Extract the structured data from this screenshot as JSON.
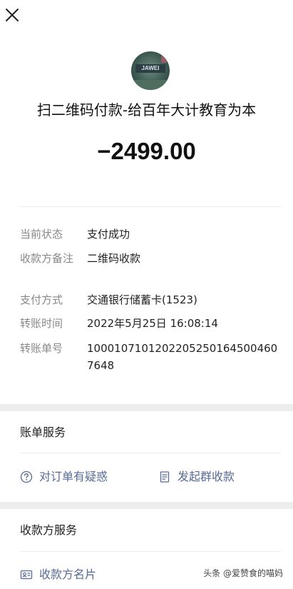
{
  "header": {
    "close_icon": "close-icon"
  },
  "merchant": {
    "avatar_text": "JAWEI",
    "title": "扫二维码付款-给百年大计教育为本"
  },
  "amount": "−2499.00",
  "details": [
    {
      "label": "当前状态",
      "value": "支付成功"
    },
    {
      "label": "收款方备注",
      "value": "二维码收款"
    },
    {
      "label": "支付方式",
      "value": "交通银行储蓄卡(1523)"
    },
    {
      "label": "转账时间",
      "value": "2022年5月25日 16:08:14"
    },
    {
      "label": "转账单号",
      "value": "100010710120220525016450046076​48"
    }
  ],
  "bill_service": {
    "title": "账单服务",
    "question_action": {
      "label": "对订单有疑惑",
      "icon": "question-circle-icon"
    },
    "group_collect_action": {
      "label": "发起群收款",
      "icon": "receipt-icon"
    }
  },
  "payee_service": {
    "title": "收款方服务",
    "card_action": {
      "label": "收款方名片",
      "icon": "id-card-icon"
    }
  },
  "watermark": "头条 @爱赞食的喵妈",
  "colors": {
    "link": "#576b95",
    "label": "#888888",
    "band": "#ededed"
  }
}
